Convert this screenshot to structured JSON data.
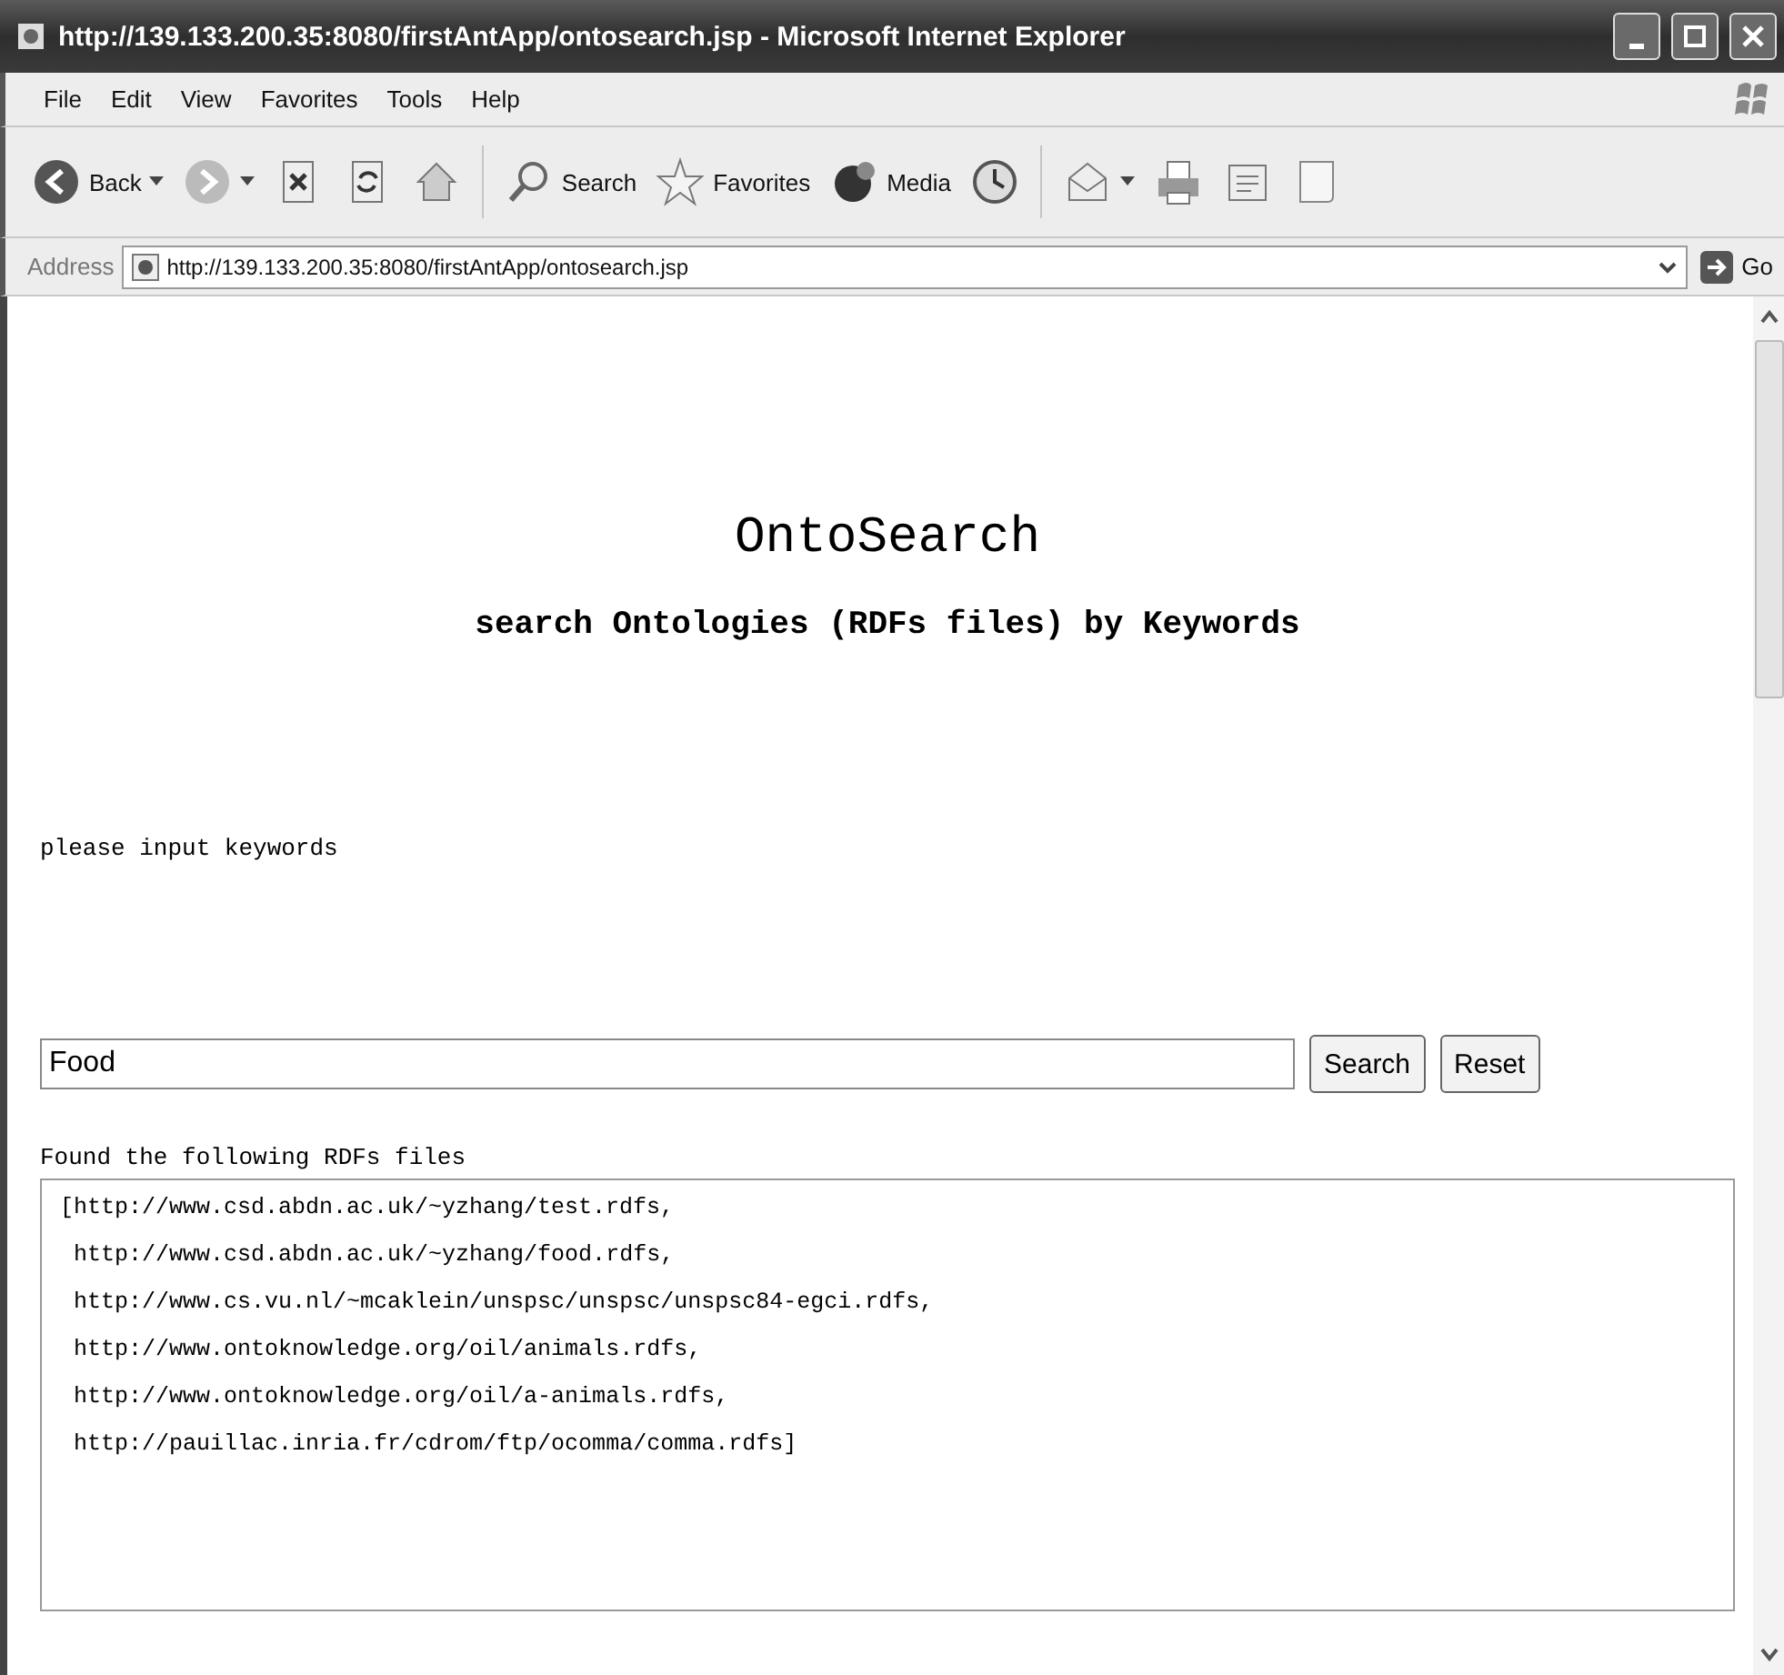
{
  "window": {
    "title": "http://139.133.200.35:8080/firstAntApp/ontosearch.jsp - Microsoft Internet Explorer"
  },
  "menu": [
    "File",
    "Edit",
    "View",
    "Favorites",
    "Tools",
    "Help"
  ],
  "toolbar": [
    {
      "kind": "back",
      "label": "Back"
    },
    {
      "kind": "forward"
    },
    {
      "kind": "stop"
    },
    {
      "kind": "refresh"
    },
    {
      "kind": "home"
    },
    {
      "kind": "search",
      "label": "Search"
    },
    {
      "kind": "favorites",
      "label": "Favorites"
    },
    {
      "kind": "media",
      "label": "Media"
    },
    {
      "kind": "history"
    },
    {
      "kind": "mail"
    },
    {
      "kind": "print"
    },
    {
      "kind": "edit"
    },
    {
      "kind": "discuss"
    }
  ],
  "address": {
    "label": "Address",
    "value": "http://139.133.200.35:8080/firstAntApp/ontosearch.jsp",
    "go": "Go"
  },
  "page": {
    "heading": "OntoSearch",
    "subheading": "search Ontologies (RDFs files) by Keywords",
    "prompt": "please input keywords",
    "keywords": "Food",
    "buttons": [
      "Search",
      "Reset"
    ],
    "results_label": "Found the following RDFs files",
    "results": "[http://www.csd.abdn.ac.uk/~yzhang/test.rdfs,\n http://www.csd.abdn.ac.uk/~yzhang/food.rdfs,\n http://www.cs.vu.nl/~mcaklein/unspsc/unspsc/unspsc84-egci.rdfs,\n http://www.ontoknowledge.org/oil/animals.rdfs,\n http://www.ontoknowledge.org/oil/a-animals.rdfs,\n http://pauillac.inria.fr/cdrom/ftp/ocomma/comma.rdfs]"
  }
}
